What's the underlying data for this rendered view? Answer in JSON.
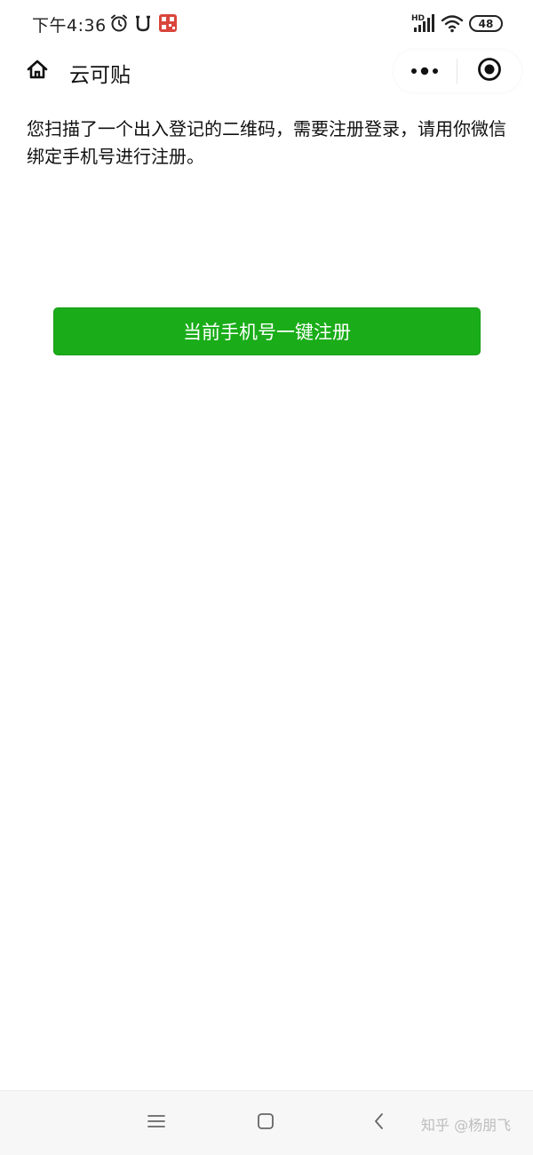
{
  "status_bar": {
    "time": "下午4:36",
    "signal_label": "HD",
    "battery_level": "48",
    "icons": [
      "alarm-icon",
      "bell-icon",
      "app-badge-icon",
      "signal-icon",
      "wifi-icon",
      "battery-icon"
    ]
  },
  "nav": {
    "title": "云可贴",
    "icons": [
      "home-icon",
      "more-icon",
      "close-target-icon"
    ]
  },
  "content": {
    "message": "您扫描了一个出入登记的二维码，需要注册登录，请用你微信绑定手机号进行注册。",
    "register_button_label": "当前手机号一键注册"
  },
  "system_nav": {
    "icons": [
      "menu-icon",
      "home-square-icon",
      "back-icon"
    ],
    "watermark": "知乎 @杨朋飞"
  },
  "colors": {
    "accent": "#1aad19",
    "background": "#ffffff"
  }
}
